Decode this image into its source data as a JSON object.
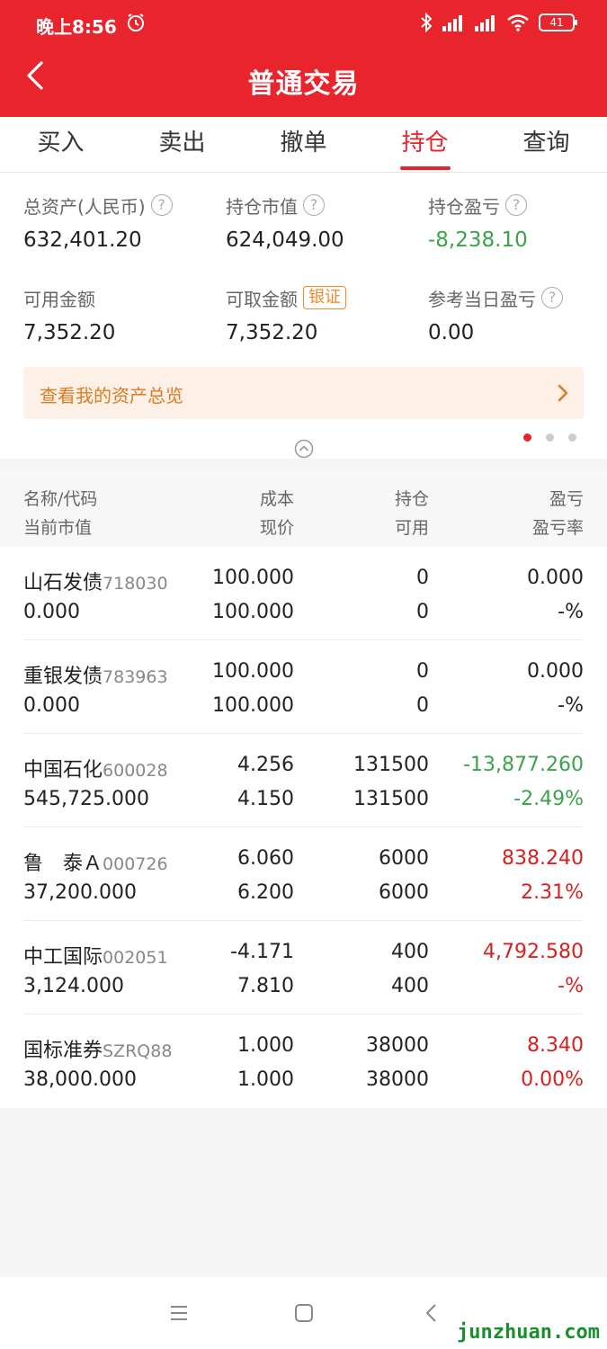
{
  "status_bar": {
    "time": "晚上8:56",
    "battery": "41"
  },
  "header": {
    "title": "普通交易"
  },
  "tabs": [
    {
      "label": "买入",
      "active": false
    },
    {
      "label": "卖出",
      "active": false
    },
    {
      "label": "撤单",
      "active": false
    },
    {
      "label": "持仓",
      "active": true
    },
    {
      "label": "查询",
      "active": false
    }
  ],
  "summary": {
    "total_assets": {
      "label": "总资产(人民币)",
      "value": "632,401.20"
    },
    "market_value": {
      "label": "持仓市值",
      "value": "624,049.00"
    },
    "position_pnl": {
      "label": "持仓盈亏",
      "value": "-8,238.10"
    },
    "available": {
      "label": "可用金额",
      "value": "7,352.20"
    },
    "withdrawable": {
      "label": "可取金额",
      "tag": "银证",
      "value": "7,352.20"
    },
    "today_pnl": {
      "label": "参考当日盈亏",
      "value": "0.00"
    },
    "overview_link": "查看我的资产总览"
  },
  "table": {
    "headers": {
      "name_code": "名称/代码",
      "market_value": "当前市值",
      "cost": "成本",
      "price": "现价",
      "holding": "持仓",
      "available": "可用",
      "pnl": "盈亏",
      "pnl_rate": "盈亏率"
    },
    "rows": [
      {
        "name": "山石发债",
        "code": "718030",
        "market_value": "0.000",
        "cost": "100.000",
        "price": "100.000",
        "holding": "0",
        "available": "0",
        "pnl": "0.000",
        "pnl_rate": "-%",
        "trend": "flat"
      },
      {
        "name": "重银发债",
        "code": "783963",
        "market_value": "0.000",
        "cost": "100.000",
        "price": "100.000",
        "holding": "0",
        "available": "0",
        "pnl": "0.000",
        "pnl_rate": "-%",
        "trend": "flat"
      },
      {
        "name": "中国石化",
        "code": "600028",
        "market_value": "545,725.000",
        "cost": "4.256",
        "price": "4.150",
        "holding": "131500",
        "available": "131500",
        "pnl": "-13,877.260",
        "pnl_rate": "-2.49%",
        "trend": "down"
      },
      {
        "name": "鲁　泰Ａ",
        "code": "000726",
        "market_value": "37,200.000",
        "cost": "6.060",
        "price": "6.200",
        "holding": "6000",
        "available": "6000",
        "pnl": "838.240",
        "pnl_rate": "2.31%",
        "trend": "up"
      },
      {
        "name": "中工国际",
        "code": "002051",
        "market_value": "3,124.000",
        "cost": "-4.171",
        "price": "7.810",
        "holding": "400",
        "available": "400",
        "pnl": "4,792.580",
        "pnl_rate": "-%",
        "trend": "up"
      },
      {
        "name": "国标准券",
        "code": "SZRQ88",
        "market_value": "38,000.000",
        "cost": "1.000",
        "price": "1.000",
        "holding": "38000",
        "available": "38000",
        "pnl": "8.340",
        "pnl_rate": "0.00%",
        "trend": "up"
      }
    ]
  },
  "colors": {
    "brand": "#e8242c",
    "gain": "#d9201f",
    "loss": "#3aa34a",
    "accent": "#f28a2b"
  },
  "watermark": "junzhuan.com"
}
